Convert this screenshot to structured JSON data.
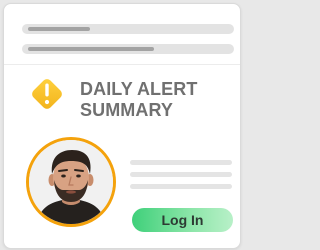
{
  "alert": {
    "title_line_1": "DAILY ALERT",
    "title_line_2": "SUMMARY",
    "icon": "warning-diamond-icon"
  },
  "profile": {
    "avatar": "avatar-photo"
  },
  "actions": {
    "login_label": "Log In"
  },
  "colors": {
    "warning": "#f5c92a",
    "avatar_ring": "#f4a20c",
    "button_start": "#3fd07a",
    "button_end": "#b8f0c8",
    "title_text": "#707070"
  }
}
